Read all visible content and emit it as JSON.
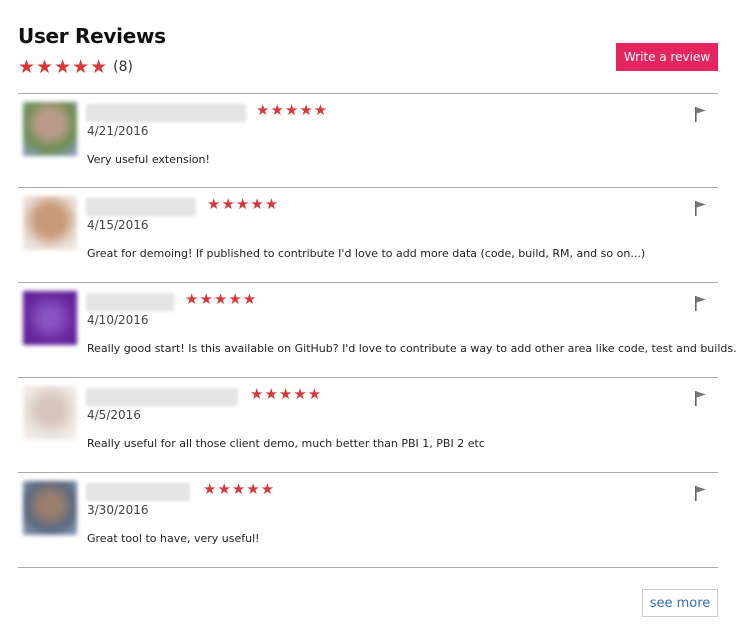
{
  "header": {
    "title": "User Reviews",
    "rating_stars": "★★★★★",
    "review_count": "(8)",
    "write_review_label": "Write a review"
  },
  "reviews": [
    {
      "stars": "★★★★★",
      "date": "4/21/2016",
      "comment": "Very useful extension!",
      "avatar_color": "#6e8f55"
    },
    {
      "stars": "★★★★★",
      "date": "4/15/2016",
      "comment": "Great for demoing! If published to contribute I'd love to add more data (code, build, RM, and so on...)",
      "avatar_color": "#c9a48a"
    },
    {
      "stars": "★★★★★",
      "date": "4/10/2016",
      "comment": "Really good start! Is this available on GitHub? I'd love to contribute a way to add other area like code, test and builds.",
      "avatar_color": "#6a2aa0"
    },
    {
      "stars": "★★★★★",
      "date": "4/5/2016",
      "comment": "Really useful for all those client demo, much better than PBI 1, PBI 2 etc",
      "avatar_color": "#e6dcd6"
    },
    {
      "stars": "★★★★★",
      "date": "3/30/2016",
      "comment": "Great tool to have, very useful!",
      "avatar_color": "#5b6a80"
    }
  ],
  "footer": {
    "see_more_label": "see more"
  },
  "colors": {
    "accent": "#e6245e",
    "star": "#d9383a",
    "link": "#2f6cbf"
  },
  "icons": {
    "flag": "flag-icon"
  }
}
